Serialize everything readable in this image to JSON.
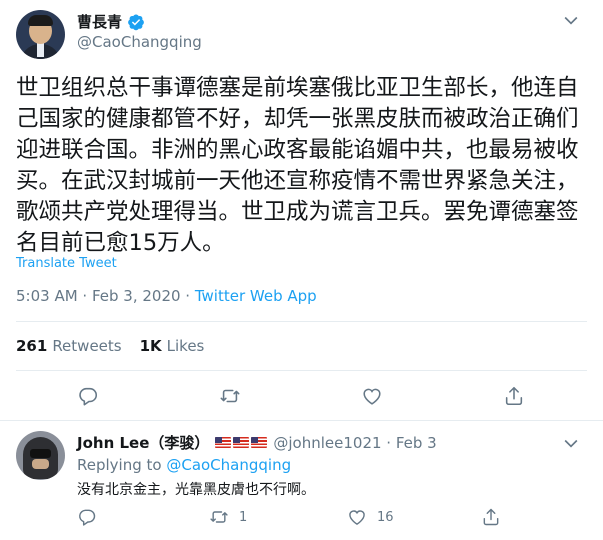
{
  "tweet": {
    "author_name": "曹長青",
    "author_handle": "@CaoChangqing",
    "text": "世卫组织总干事谭德塞是前埃塞俄比亚卫生部长，他连自己国家的健康都管不好，却凭一张黑皮肤而被政治正确们迎进联合国。非洲的黑心政客最能谄媚中共，也最易被收买。在武汉封城前一天他还宣称疫情不需世界紧急关注，歌颂共产党处理得当。世卫成为谎言卫兵。罢免谭德塞签名目前已愈15万人。",
    "translate_label": "Translate Tweet",
    "time": "5:03 AM · Feb 3, 2020 · ",
    "source": "Twitter Web App",
    "retweets_count": "261",
    "retweets_label": "Retweets",
    "likes_count": "1K",
    "likes_label": "Likes"
  },
  "reply": {
    "author_name": "John Lee（李骏）",
    "flags": [
      "🇺🇸",
      "🇺🇸",
      "🇺🇸"
    ],
    "author_handle": "@johnlee1021 · Feb 3",
    "replying_prefix": "Replying to ",
    "replying_to": "@CaoChangqing",
    "text": "没有北京金主，光靠黑皮膚也不行啊。",
    "retweet_count": "1",
    "like_count": "16"
  },
  "colors": {
    "accent": "#1da1f2",
    "secondary_text": "#657786",
    "divider": "#e6ecf0"
  },
  "icons": [
    "verified-badge-icon",
    "chevron-down-icon",
    "reply-icon",
    "retweet-icon",
    "like-icon",
    "share-icon"
  ]
}
